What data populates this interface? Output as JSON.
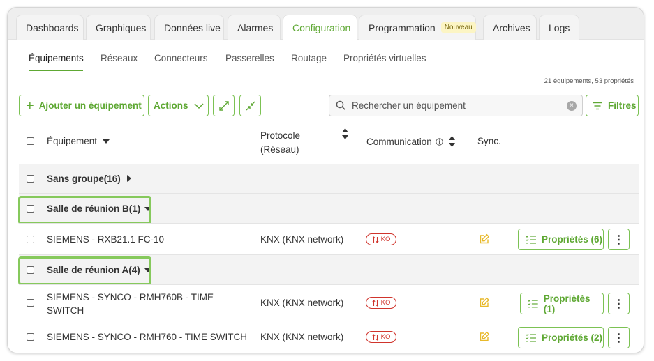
{
  "main_tabs": [
    {
      "label": "Dashboards"
    },
    {
      "label": "Graphiques"
    },
    {
      "label": "Données live"
    },
    {
      "label": "Alarmes"
    },
    {
      "label": "Configuration"
    },
    {
      "label": "Programmation",
      "badge": "Nouveau"
    },
    {
      "label": "Archives"
    },
    {
      "label": "Logs"
    }
  ],
  "sub_tabs": [
    {
      "label": "Équipements"
    },
    {
      "label": "Réseaux"
    },
    {
      "label": "Connecteurs"
    },
    {
      "label": "Passerelles"
    },
    {
      "label": "Routage"
    },
    {
      "label": "Propriétés virtuelles"
    }
  ],
  "summary": "21 équipements, 53 propriétés",
  "toolbar": {
    "add_label": "Ajouter un équipement",
    "actions_label": "Actions",
    "filters_label": "Filtres"
  },
  "search": {
    "placeholder": "Rechercher un équipement"
  },
  "table": {
    "headers": {
      "equipment": "Équipement",
      "protocol_line1": "Protocole",
      "protocol_line2": "(Réseau)",
      "communication": "Communication",
      "sync": "Sync."
    },
    "groups": [
      {
        "label": "Sans groupe(16)"
      },
      {
        "label": "Salle de réunion B(1)"
      },
      {
        "label": "Salle de réunion A(4)"
      }
    ],
    "rows": [
      {
        "name": "SIEMENS - RXB21.1 FC-10",
        "protocol": "KNX (KNX network)",
        "status": "KO",
        "properties": "Propriétés (6)"
      },
      {
        "name_line1": "SIEMENS - SYNCO - RMH760B - TIME",
        "name_line2": "SWITCH",
        "protocol": "KNX (KNX network)",
        "status": "KO",
        "properties": "Propriétés (1)"
      },
      {
        "name": "SIEMENS - SYNCO - RMH760 - TIME SWITCH",
        "protocol": "KNX (KNX network)",
        "status": "KO",
        "properties": "Propriétés (2)"
      }
    ]
  },
  "colors": {
    "accent": "#5ea833",
    "highlight": "#86c95c",
    "error": "#d0342c",
    "sync": "#e8b92a"
  }
}
